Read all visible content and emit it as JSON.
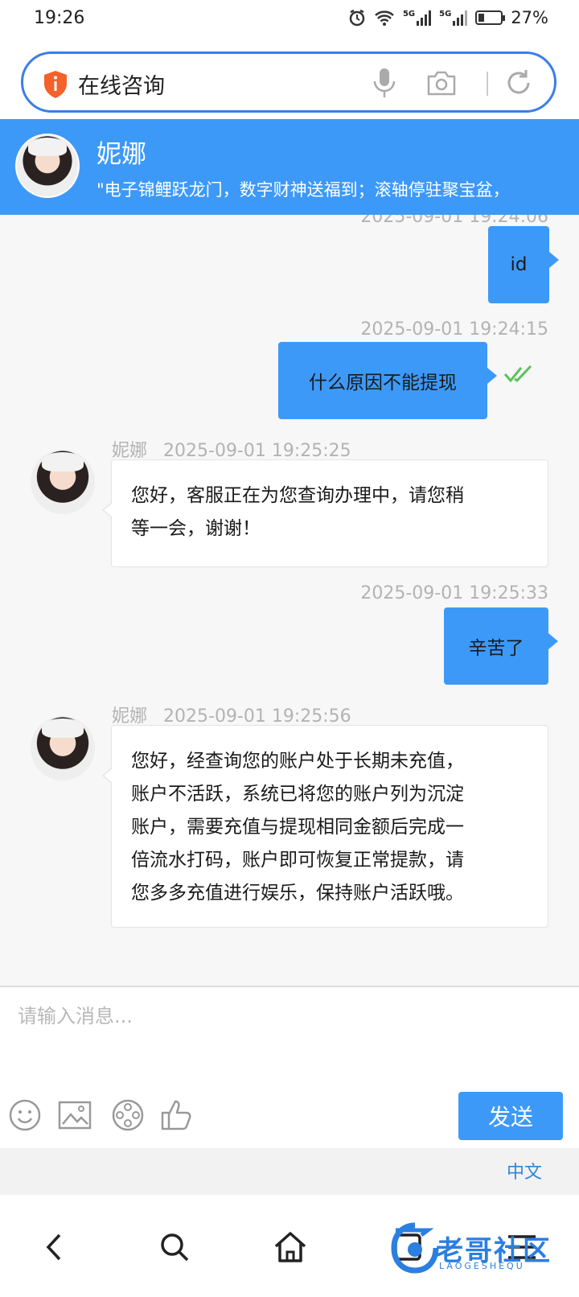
{
  "status_bar": {
    "time": "19:26",
    "battery": "27%",
    "battery_level": 0.27,
    "network_1": "5G",
    "network_2": "5G"
  },
  "browser": {
    "search_text": "在线咨询",
    "security_icon": "shield-alert-icon",
    "icons": [
      "microphone-icon",
      "camera-icon",
      "reload-icon"
    ],
    "accent_color": "#3a7ee8"
  },
  "chat_header": {
    "agent_name": "妮娜",
    "marquee": "\"电子锦鲤跃龙门，数字财神送福到；滚轴停驻聚宝盆，",
    "color": "#3d99f8"
  },
  "messages": [
    {
      "direction": "out",
      "time": "2025-09-01 19:24:06",
      "text": "id"
    },
    {
      "direction": "out",
      "time": "2025-09-01 19:24:15",
      "text": "什么原因不能提现",
      "status": "read"
    },
    {
      "direction": "in",
      "sender": "妮娜",
      "time": "2025-09-01 19:25:25",
      "lines": [
        "您好，客服正在为您查询办理中，请您稍",
        "等一会，谢谢！"
      ]
    },
    {
      "direction": "out",
      "time": "2025-09-01 19:25:33",
      "text": "辛苦了"
    },
    {
      "direction": "in",
      "sender": "妮娜",
      "time": "2025-09-01 19:25:56",
      "lines": [
        "您好，经查询您的账户处于长期未充值，",
        "账户不活跃，系统已将您的账户列为沉淀",
        "账户，需要充值与提现相同金额后完成一",
        "倍流水打码，账户即可恢复正常提款，请",
        "您多多充值进行娱乐，保持账户活跃哦。"
      ]
    }
  ],
  "composer": {
    "placeholder": "请输入消息...",
    "send_label": "发送",
    "tools": [
      "emoji-icon",
      "image-icon",
      "video-icon",
      "thumbs-up-icon"
    ],
    "language": "中文"
  },
  "nav": {
    "icons": [
      "back-icon",
      "search-icon",
      "home-icon",
      "tabs-icon",
      "menu-icon"
    ]
  },
  "watermark": {
    "text": "老哥社区",
    "sub": "LAOGESHEQU"
  }
}
